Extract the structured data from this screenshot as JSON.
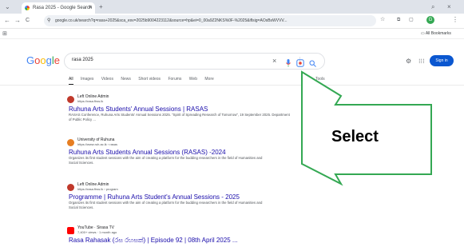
{
  "browser": {
    "tab_title": "Rasa 2025 - Google Search",
    "tab_close": "×",
    "new_tab": "+",
    "url": "google.co.uk/search?q=rasa+2025&sca_esv=2025b9004223112&source=hp&ei=0_00a9Z2NKS%0F-%2025&iflsig=AOsBsWVVV...",
    "back": "←",
    "forward": "→",
    "reload": "C",
    "bookmark_label": "All Bookmarks",
    "profile_initial": "G"
  },
  "google": {
    "logo": [
      "G",
      "o",
      "o",
      "g",
      "l",
      "e"
    ],
    "logo_colors": [
      "#4285f4",
      "#ea4335",
      "#fbbc05",
      "#4285f4",
      "#34a853",
      "#ea4335"
    ],
    "query": "rasa 2025",
    "clear_icon": "×",
    "signin": "Sign in",
    "tabs": [
      "All",
      "Images",
      "Videos",
      "News",
      "Short videos",
      "Forums",
      "Web",
      "More"
    ],
    "tools": "Tools"
  },
  "results": [
    {
      "site": "Left Online Admin",
      "cite": "https://rasa.fhss.lk",
      "title": "Ruhuna Arts Students' Annual Sessions | RASAS",
      "snippet": "RASAS Conference, Ruhuna Arts Students' Annual Sessions 2025. \"Spirit of Spreading Research of Tomorrow\", 19 September 2025. Department of Public Policy ...",
      "icon_color": "#c0392b"
    },
    {
      "site": "University of Ruhuna",
      "cite": "https://www.ruh.ac.lk › rasas",
      "title": "Ruhuna Arts Students Annual Sessions (RASAS) -2024",
      "snippet": "Organizes its first student sessions with the aim of creating a platform for the budding researchers in the field of Humanities and Social Sciences.",
      "icon_color": "#e67e22"
    },
    {
      "site": "Left Online Admin",
      "cite": "https://rasa.fhss.lk › program",
      "title": "Programme | Ruhuna Arts Student's Annual Sessions - 2025",
      "snippet": "Organizes its first student sessions with the aim of creating a platform for the budding researchers in the field of Humanities and Social Sciences.",
      "icon_color": "#c0392b"
    },
    {
      "site": "YouTube · Sirasa TV",
      "cite": "7,400+ views · 1 month ago",
      "title": "Rasa Rahasak (රස රහසක්) | Episode 92 | 08th April 2025 ...",
      "snippet": "",
      "icon_color": "#ff0000"
    }
  ],
  "annotation": {
    "label": "Select",
    "arrow_color": "#34a853"
  }
}
